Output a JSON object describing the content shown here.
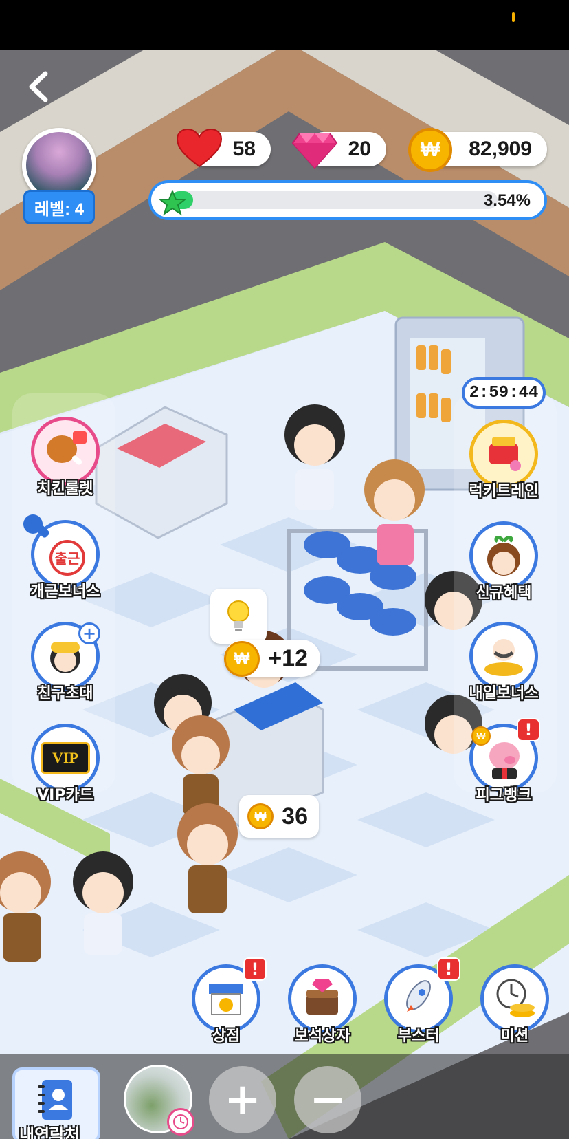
{
  "hud": {
    "level_label": "레벨: 4",
    "hearts": "58",
    "gems": "20",
    "coins": "82,909",
    "coin_symbol": "₩",
    "progress_text": "3.54%",
    "progress_value": 0.0354
  },
  "left_menu": [
    {
      "label": "치킨룰렛",
      "icon": "chicken-roulette-icon"
    },
    {
      "label": "개근보너스",
      "icon": "attendance-stamp-icon",
      "stamp_text": "출근"
    },
    {
      "label": "친구초대",
      "icon": "friend-invite-icon"
    },
    {
      "label": "VIP카드",
      "icon": "vip-card-icon",
      "card_text": "VIP"
    }
  ],
  "right_menu": [
    {
      "label": "럭키트레인",
      "icon": "lucky-train-icon",
      "timer": "2:59:44"
    },
    {
      "label": "신규혜택",
      "icon": "new-benefit-icon"
    },
    {
      "label": "내일보너스",
      "icon": "tomorrow-bonus-icon"
    },
    {
      "label": "피그뱅크",
      "icon": "piggy-bank-icon",
      "alert": "!"
    }
  ],
  "scene": {
    "earn_popup": "+12",
    "counter_coins": "36",
    "idea_icon": "lightbulb-icon"
  },
  "bottom_actions": [
    {
      "label": "상점",
      "icon": "shop-icon",
      "alert": "!"
    },
    {
      "label": "보석상자",
      "icon": "gem-chest-icon"
    },
    {
      "label": "부스터",
      "icon": "rocket-booster-icon",
      "alert": "!"
    },
    {
      "label": "미션",
      "icon": "mission-clock-icon"
    }
  ],
  "bottom_bar": {
    "contacts_label": "내연락처",
    "zoom_in": "+",
    "zoom_out": "−"
  }
}
